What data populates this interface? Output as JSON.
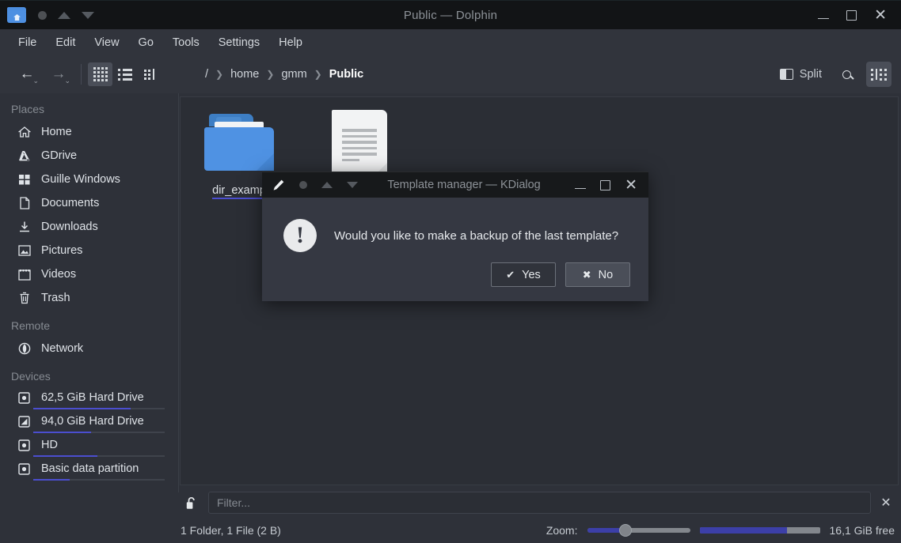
{
  "window": {
    "title": "Public — Dolphin",
    "app_icon": "folder-home-icon",
    "controls": {
      "minimize": "–",
      "maximize": "□",
      "close": "✕"
    }
  },
  "menubar": {
    "items": [
      {
        "label": "File"
      },
      {
        "label": "Edit"
      },
      {
        "label": "View"
      },
      {
        "label": "Go"
      },
      {
        "label": "Tools"
      },
      {
        "label": "Settings"
      },
      {
        "label": "Help"
      }
    ]
  },
  "toolbar": {
    "back": "←",
    "forward": "→",
    "view_modes": [
      {
        "name": "icons-view",
        "active": true
      },
      {
        "name": "details-view",
        "active": false
      },
      {
        "name": "compact-view",
        "active": false
      }
    ],
    "breadcrumb": {
      "root": "/",
      "items": [
        {
          "label": "home"
        },
        {
          "label": "gmm"
        },
        {
          "label": "Public",
          "current": true
        }
      ],
      "separator": "❯"
    },
    "split_label": "Split",
    "search_icon": "search-icon",
    "control_icon": "control-menu-icon"
  },
  "sidebar": {
    "groups": [
      {
        "title": "Places",
        "items": [
          {
            "label": "Home",
            "icon": "home-icon"
          },
          {
            "label": "GDrive",
            "icon": "gdrive-icon"
          },
          {
            "label": "Guille Windows",
            "icon": "windows-icon"
          },
          {
            "label": "Documents",
            "icon": "document-icon"
          },
          {
            "label": "Downloads",
            "icon": "download-icon"
          },
          {
            "label": "Pictures",
            "icon": "picture-icon"
          },
          {
            "label": "Videos",
            "icon": "video-icon"
          },
          {
            "label": "Trash",
            "icon": "trash-icon"
          }
        ]
      },
      {
        "title": "Remote",
        "items": [
          {
            "label": "Network",
            "icon": "network-icon"
          }
        ]
      },
      {
        "title": "Devices",
        "items": [
          {
            "label": "62,5 GiB Hard Drive",
            "icon": "harddrive-icon",
            "capacity_percent": 74
          },
          {
            "label": "94,0 GiB Hard Drive",
            "icon": "harddrive-icon",
            "capacity_percent": 44
          },
          {
            "label": "HD",
            "icon": "harddrive-icon",
            "capacity_percent": 49
          },
          {
            "label": "Basic data partition",
            "icon": "harddrive-icon",
            "capacity_percent": 28
          }
        ]
      }
    ]
  },
  "files": [
    {
      "name": "dir_examp",
      "icon": "folder-icon",
      "type": "folder"
    },
    {
      "name": "",
      "icon": "text-file-icon",
      "type": "file"
    }
  ],
  "filter": {
    "lock_icon": "unlock-icon",
    "placeholder": "Filter...",
    "value": "",
    "close": "✕"
  },
  "status": {
    "summary": "1 Folder, 1 File (2 B)",
    "zoom_label": "Zoom:",
    "zoom_percent": 37,
    "free_space_percent": 73,
    "free_space_label": "16,1 GiB free"
  },
  "dialog": {
    "title": "Template manager — KDialog",
    "icons": {
      "edit": "pencil-icon",
      "dot": "dot-icon",
      "up": "triangle-up-icon",
      "down": "triangle-down-icon"
    },
    "controls": {
      "minimize": "–",
      "maximize": "□",
      "close": "✕"
    },
    "warning_icon": "!",
    "message": "Would you like to make a backup of the last template?",
    "buttons": [
      {
        "label": "Yes",
        "glyph": "✔",
        "style": "default"
      },
      {
        "label": "No",
        "glyph": "✖",
        "style": "normal"
      }
    ]
  },
  "colors": {
    "accent": "#4b4ecf",
    "folder_blue": "#4f92e3",
    "window_bg": "#2e3139",
    "titlebar_bg": "#121416"
  }
}
